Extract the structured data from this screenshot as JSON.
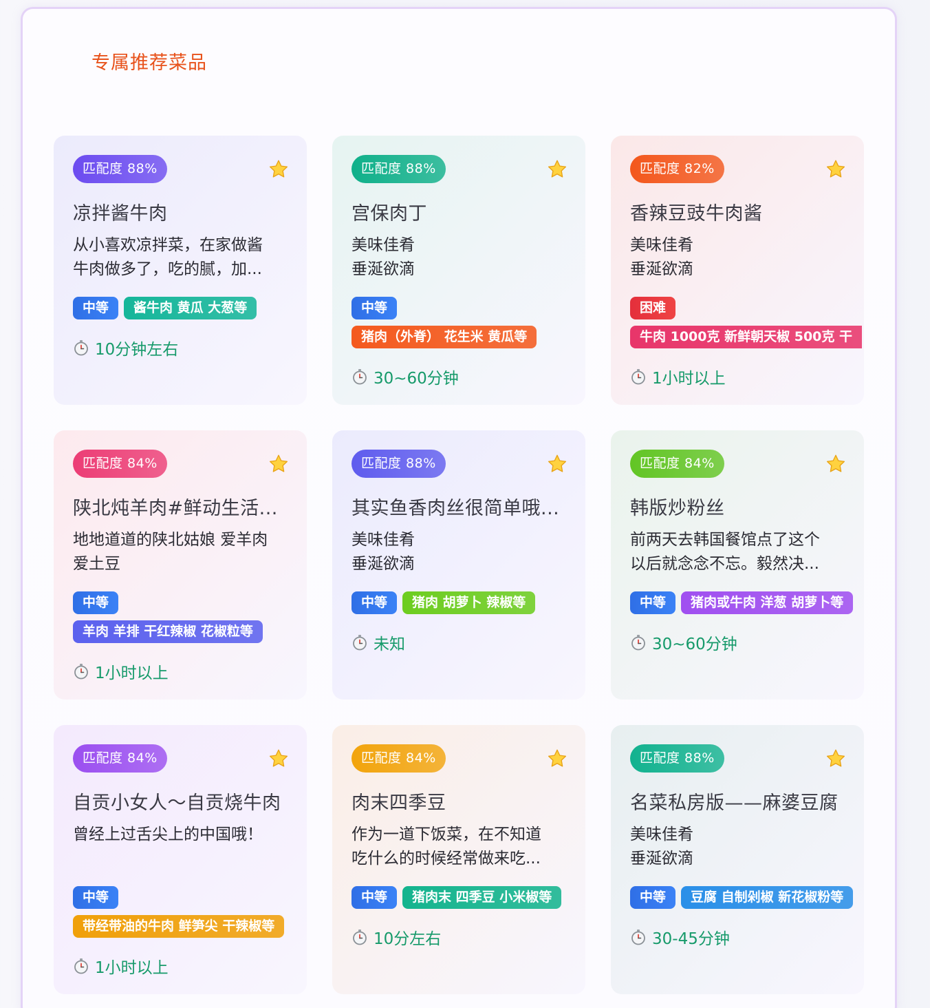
{
  "section_title": "专属推荐菜品",
  "cards": [
    {
      "match": "匹配度 88%",
      "title": "凉拌酱牛肉",
      "desc": [
        "从小喜欢凉拌菜，在家做酱",
        "牛肉做多了，吃的腻，加..."
      ],
      "difficulty": "中等",
      "ingredients": "酱牛肉 黄瓜 大葱等",
      "time": "10分钟左右",
      "colors": {
        "card": "#ecebfc",
        "match": "#6c4cf0",
        "ing": "#16b69a"
      }
    },
    {
      "match": "匹配度 88%",
      "title": "宫保肉丁",
      "desc": [
        "美味佳肴",
        "垂涎欲滴"
      ],
      "difficulty": "中等",
      "ingredients": "猪肉（外脊） 花生米 黄瓜等",
      "time": "30~60分钟",
      "colors": {
        "card": "#e6f4f1",
        "match": "#10b08a",
        "ing": "#f45a1e"
      }
    },
    {
      "match": "匹配度 82%",
      "title": "香辣豆豉牛肉酱",
      "desc": [
        "美味佳肴",
        "垂涎欲滴"
      ],
      "difficulty": "困难",
      "ingredients": "牛肉 1000克 新鲜朝天椒 500克 干",
      "time": "1小时以上",
      "colors": {
        "card": "#fbe8e8",
        "match": "#f3571c",
        "ing": "#e8356a"
      }
    },
    {
      "match": "匹配度 84%",
      "title": "陕北炖羊肉#鲜动生活...",
      "desc": [
        "地地道道的陕北姑娘 爱羊肉",
        "爱土豆"
      ],
      "difficulty": "中等",
      "ingredients": "羊肉 羊排 干红辣椒 花椒粒等",
      "time": "1小时以上",
      "colors": {
        "card": "#fdeaee",
        "match": "#ec3d75",
        "ing": "#5b61ee"
      }
    },
    {
      "match": "匹配度 88%",
      "title": "其实鱼香肉丝很简单哦...",
      "desc": [
        "美味佳肴",
        "垂涎欲滴"
      ],
      "difficulty": "中等",
      "ingredients": "猪肉 胡萝卜 辣椒等",
      "time": "未知",
      "colors": {
        "card": "#ebebfd",
        "match": "#5f5cee",
        "ing": "#6dcd20"
      }
    },
    {
      "match": "匹配度 84%",
      "title": "韩版炒粉丝",
      "desc": [
        "前两天去韩国餐馆点了这个",
        "以后就念念不忘。毅然决..."
      ],
      "difficulty": "中等",
      "ingredients": "猪肉或牛肉 洋葱 胡萝卜等",
      "time": "30~60分钟",
      "colors": {
        "card": "#eaf3ec",
        "match": "#62c524",
        "ing": "#a04ff0"
      }
    },
    {
      "match": "匹配度 84%",
      "title": "自贡小女人～自贡烧牛肉",
      "desc": [
        "曾经上过舌尖上的中国哦！",
        ""
      ],
      "difficulty": "中等",
      "ingredients": "带经带油的牛肉 鲜笋尖 干辣椒等",
      "time": "1小时以上",
      "colors": {
        "card": "#f4eafd",
        "match": "#9b4ff0",
        "ing": "#f0a00a"
      }
    },
    {
      "match": "匹配度 84%",
      "title": "肉末四季豆",
      "desc": [
        "作为一道下饭菜，在不知道",
        "吃什么的时候经常做来吃..."
      ],
      "difficulty": "中等",
      "ingredients": "猪肉末 四季豆 小米椒等",
      "time": "10分左右",
      "colors": {
        "card": "#faeee6",
        "match": "#f2a40c",
        "ing": "#14b48e"
      }
    },
    {
      "match": "匹配度 88%",
      "title": "名菜私房版——麻婆豆腐",
      "desc": [
        "美味佳肴",
        "垂涎欲滴"
      ],
      "difficulty": "中等",
      "ingredients": "豆腐 自制剁椒 新花椒粉等",
      "time": "30-45分钟",
      "colors": {
        "card": "#e7eff0",
        "match": "#12b28f",
        "ing": "#2a8fe8"
      }
    }
  ]
}
